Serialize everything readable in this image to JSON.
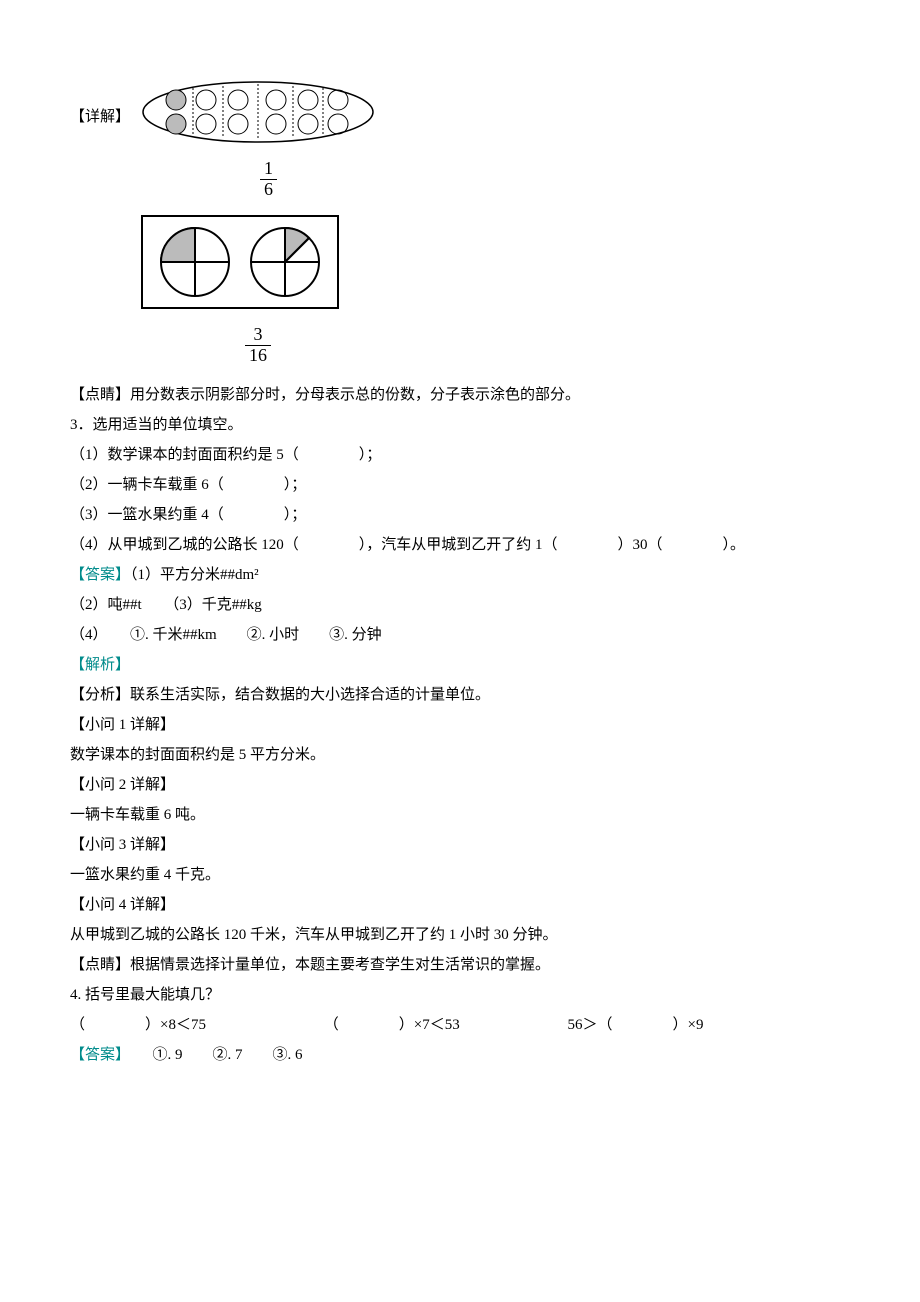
{
  "q2": {
    "label_detail": "【详解】",
    "fraction1_num": "1",
    "fraction1_den": "6",
    "fraction2_num": "3",
    "fraction2_den": "16",
    "dianjing": "【点睛】用分数表示阴影部分时，分母表示总的份数，分子表示涂色的部分。"
  },
  "q3": {
    "title": "3．选用适当的单位填空。",
    "item1": "（1）数学课本的封面面积约是 5（　　　　）；",
    "item2": "（2）一辆卡车载重 6（　　　　）；",
    "item3": "（3）一篮水果约重 4（　　　　）；",
    "item4": "（4）从甲城到乙城的公路长 120（　　　　），汽车从甲城到乙开了约 1（　　　　）30（　　　　）。",
    "answer_label": "【答案】",
    "ans1": "（1）平方分米##dm²",
    "ans2": "（2）吨##t",
    "ans3": "（3）千克##kg",
    "ans4": "（4）　　①. 千米##km　　②. 小时　　③. 分钟",
    "jiexi_label": "【解析】",
    "fenxi": "【分析】联系生活实际，结合数据的大小选择合适的计量单位。",
    "sub1_label": "【小问 1 详解】",
    "sub1_text": "数学课本的封面面积约是 5 平方分米。",
    "sub2_label": "【小问 2 详解】",
    "sub2_text": "一辆卡车载重 6 吨。",
    "sub3_label": "【小问 3 详解】",
    "sub3_text": "一篮水果约重 4 千克。",
    "sub4_label": "【小问 4 详解】",
    "sub4_text": "从甲城到乙城的公路长 120 千米，汽车从甲城到乙开了约 1 小时 30 分钟。",
    "dianjing": "【点睛】根据情景选择计量单位，本题主要考查学生对生活常识的掌握。"
  },
  "q4": {
    "title": "4. 括号里最大能填几？",
    "expr1": "（　　　　）×8＜75",
    "expr2": "（　　　　）×7＜53",
    "expr3": "56＞（　　　　）×9",
    "answer_label": "【答案】",
    "ans": "　　①. 9　　②. 7　　③. 6"
  }
}
